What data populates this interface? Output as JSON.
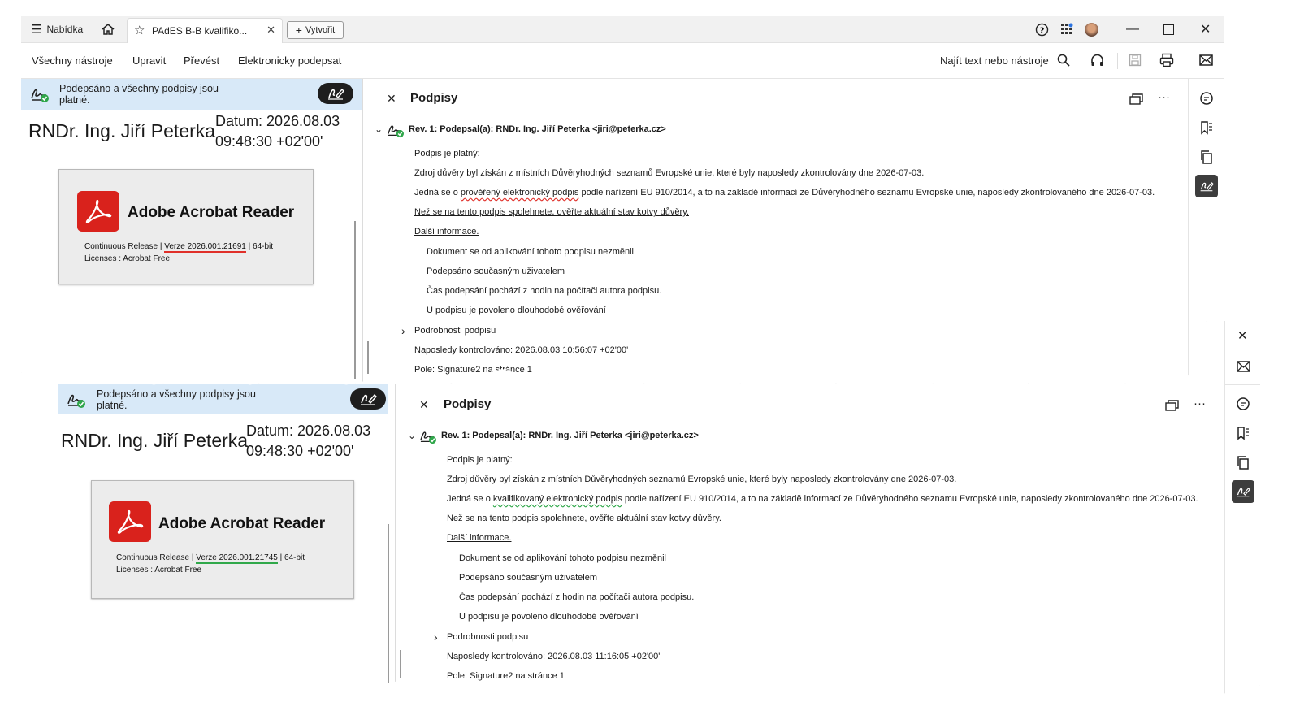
{
  "titlebar": {
    "menu_label": "Nabídka",
    "tab_title": "PAdES B-B kvalifiko...",
    "create_label": "Vytvořit"
  },
  "toolbar": {
    "all_tools": "Všechny nástroje",
    "edit": "Upravit",
    "convert": "Převést",
    "esign": "Elektronicky podepsat",
    "search_label": "Najít text nebo nástroje"
  },
  "doc_top": {
    "banner_line1": "Podepsáno a všechny podpisy jsou",
    "banner_line2": "platné.",
    "signer": "RNDr. Ing. Jiří Peterka",
    "datum_line1": "Datum: 2026.08.03",
    "datum_line2": "09:48:30 +02'00'",
    "app_name": "Adobe Acrobat Reader",
    "release_prefix": "Continuous Release | ",
    "version": "Verze 2026.001.21691",
    "release_suffix": " | 64-bit",
    "licenses": "Licenses : Acrobat Free"
  },
  "doc_bottom": {
    "banner_line1": "Podepsáno a všechny podpisy jsou",
    "banner_line2": "platné.",
    "signer": "RNDr. Ing. Jiří Peterka",
    "datum_line1": "Datum: 2026.08.03",
    "datum_line2": "09:48:30 +02'00'",
    "app_name": "Adobe Acrobat Reader",
    "release_prefix": "Continuous Release | ",
    "version": "Verze 2026.001.21745",
    "release_suffix": " | 64-bit",
    "licenses": "Licenses : Acrobat Free"
  },
  "panel_top": {
    "title": "Podpisy",
    "rev": "Rev. 1: Podepsal(a): RNDr. Ing. Jiří Peterka <jiri@peterka.cz>",
    "valid": "Podpis je platný:",
    "trust_source": "Zdroj důvěry byl získán z místních Důvěryhodných seznamů Evropské unie, které byly naposledy zkontrolovány dne 2026-07-03.",
    "type_prefix": "Jedná se o ",
    "type_term": "prověřený elektronický podpis",
    "type_suffix": " podle nařízení EU 910/2014, a to na základě informací ze Důvěryhodného seznamu Evropské unie, naposledy zkontrolovaného dne 2026-07-03.",
    "anchor_link": "Než se na tento podpis spolehnete, ověřte aktuální stav kotvy důvěry.",
    "more_info": "Další informace.",
    "item1": "Dokument se od aplikování tohoto podpisu nezměnil",
    "item2": "Podepsáno současným uživatelem",
    "item3": "Čas podepsání pochází z hodin na počítači autora podpisu.",
    "item4": "U podpisu je povoleno dlouhodobé ověřování",
    "details": "Podrobnosti podpisu",
    "last_checked": "Naposledy kontrolováno: 2026.08.03 10:56:07 +02'00'",
    "field": "Pole: Signature2 na stránce 1"
  },
  "panel_bottom": {
    "title": "Podpisy",
    "rev": "Rev. 1: Podepsal(a): RNDr. Ing. Jiří Peterka <jiri@peterka.cz>",
    "valid": "Podpis je platný:",
    "trust_source": "Zdroj důvěry byl získán z místních Důvěryhodných seznamů Evropské unie, které byly naposledy zkontrolovány dne 2026-07-03.",
    "type_prefix": "Jedná se o ",
    "type_term": "kvalifikovaný elektronický podpis",
    "type_suffix": " podle nařízení EU 910/2014, a to na základě informací ze Důvěryhodného seznamu Evropské unie, naposledy zkontrolovaného dne 2026-07-03.",
    "anchor_link": "Než se na tento podpis spolehnete, ověřte aktuální stav kotvy důvěry.",
    "more_info": "Další informace.",
    "item1": "Dokument se od aplikování tohoto podpisu nezměnil",
    "item2": "Podepsáno současným uživatelem",
    "item3": "Čas podepsání pochází z hodin na počítači autora podpisu.",
    "item4": "U podpisu je povoleno dlouhodobé ověřování",
    "details": "Podrobnosti podpisu",
    "last_checked": "Naposledy kontrolováno: 2026.08.03 11:16:05 +02'00'",
    "field": "Pole: Signature2 na stránce 1"
  },
  "colors": {
    "banner_bg": "#d8e9f8",
    "acrobat_red": "#d9221c",
    "highlight_red": "#e0302a",
    "highlight_green": "#30a84a"
  },
  "icons": [
    "hamburger-icon",
    "home-icon",
    "star-icon",
    "plus-icon",
    "help-icon",
    "apps-icon",
    "avatar",
    "minimize-icon",
    "maximize-icon",
    "close-icon",
    "search-icon",
    "headphones-icon",
    "save-icon",
    "print-icon",
    "mail-icon",
    "signed-doc-icon",
    "sign-pen-icon",
    "more-icon",
    "comment-icon",
    "bookmark-icon",
    "pages-icon",
    "chevron-down-icon",
    "chevron-right-icon"
  ]
}
